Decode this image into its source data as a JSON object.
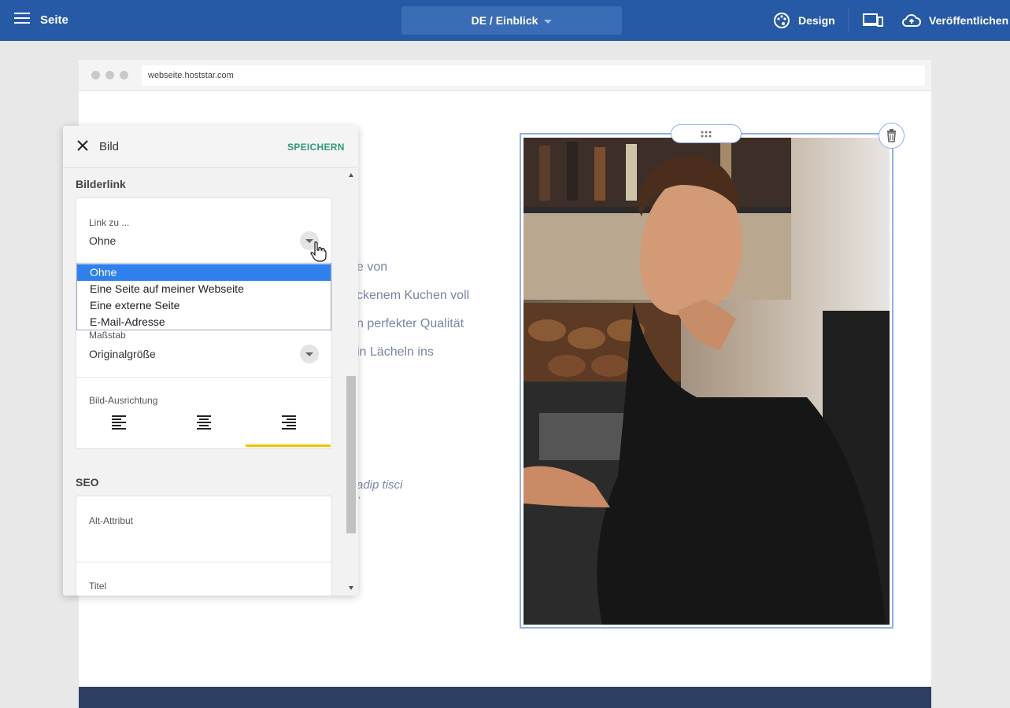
{
  "topbar": {
    "title": "Seite",
    "page_select": "DE / Einblick",
    "design_label": "Design",
    "publish_label": "Veröffentlichen"
  },
  "browser": {
    "url": "webseite.hoststar.com"
  },
  "page_content": {
    "line1": "e von",
    "line2": "ckenem Kuchen voll",
    "line3": "n perfekter Qualität",
    "line4": "in Lächeln ins",
    "quote": "adip tisci",
    "quote_mark": "\""
  },
  "panel": {
    "title": "Bild",
    "save_label": "SPEICHERN",
    "image_link_section": "Bilderlink",
    "link_label": "Link zu ...",
    "link_value": "Ohne",
    "link_options": [
      "Ohne",
      "Eine Seite auf meiner Webseite",
      "Eine externe Seite",
      "E-Mail-Adresse"
    ],
    "scale_label": "Maßstab",
    "scale_value": "Originalgröße",
    "alignment_label": "Bild-Ausrichtung",
    "seo_section": "SEO",
    "alt_label": "Alt-Attribut",
    "title_label": "Titel"
  },
  "colors": {
    "topbar": "#2659a6",
    "accent_green": "#2e9b73",
    "accent_yellow": "#f2c300",
    "selection_blue": "#2f80ed"
  }
}
